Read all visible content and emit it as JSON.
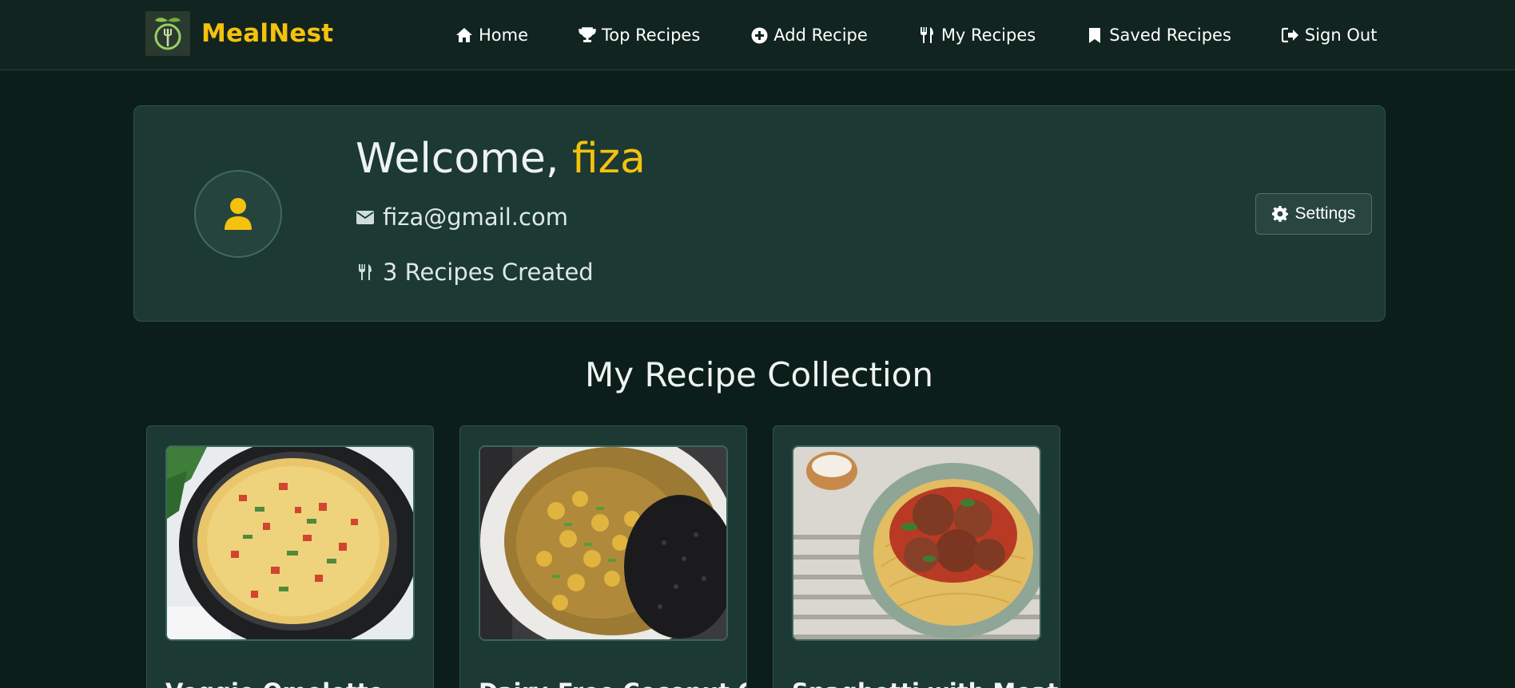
{
  "nav": {
    "brand": "MealNest",
    "links": [
      {
        "label": "Home",
        "icon": "home-icon"
      },
      {
        "label": "Top Recipes",
        "icon": "trophy-icon"
      },
      {
        "label": "Add Recipe",
        "icon": "plus-circle-icon"
      },
      {
        "label": "My Recipes",
        "icon": "utensils-icon"
      },
      {
        "label": "Saved Recipes",
        "icon": "bookmark-icon"
      },
      {
        "label": "Sign Out",
        "icon": "sign-out-icon"
      }
    ]
  },
  "profile": {
    "greeting": "Welcome, ",
    "username": "fiza",
    "email": "fiza@gmail.com",
    "recipes_created": "3 Recipes Created",
    "settings_label": "Settings"
  },
  "collection": {
    "title": "My Recipe Collection",
    "recipes": [
      {
        "title": "Veggie Omelette",
        "image": "omelette-photo"
      },
      {
        "title": "Dairy-Free Coconut Chickpea Curry",
        "image": "chickpea-curry-photo"
      },
      {
        "title": "Spaghetti with Meatballs",
        "image": "spaghetti-meatballs-photo"
      }
    ]
  },
  "colors": {
    "accent": "#f4c20d",
    "background": "#0c1e1a",
    "card": "#1c3933",
    "navbar": "#11241f"
  }
}
